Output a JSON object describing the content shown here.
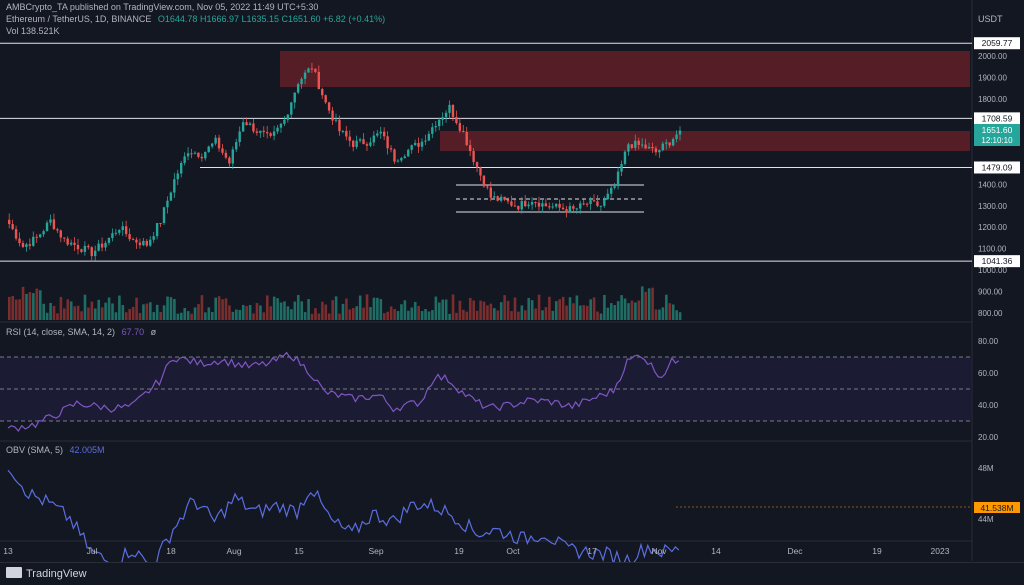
{
  "header": {
    "published": "AMBCrypto_TA published on TradingView.com, Nov 05, 2022 11:49 UTC+5:30",
    "symbol": "Ethereum / TetherUS, 1D, BINANCE",
    "ohlc": "O1644.78 H1666.97 L1635.15 C1651.60 +6.82 (+0.41%)",
    "vol": "Vol  138.521K",
    "currency": "USDT"
  },
  "indicators": {
    "rsi_label": "RSI (14, close, SMA, 14, 2)",
    "rsi_value": "67.70",
    "rsi_extra": "ø",
    "obv_label": "OBV (SMA, 5)",
    "obv_value": "42.005M"
  },
  "price_axis": {
    "ticks": [
      "2000.00",
      "1900.00",
      "1800.00",
      "1600.00",
      "1400.00",
      "1300.00",
      "1200.00",
      "1100.00",
      "1000.00",
      "900.00",
      "800.00"
    ],
    "levels": [
      "2059.77",
      "1708.59",
      "1479.09",
      "1041.36"
    ],
    "last_price": "1651.60",
    "countdown": "12:10:10"
  },
  "rsi_axis": {
    "ticks": [
      "80.00",
      "60.00",
      "40.00",
      "20.00"
    ]
  },
  "obv_axis": {
    "ticks": [
      "48M",
      "44M",
      "40M"
    ],
    "last": "41.538M"
  },
  "time_axis": [
    "13",
    "Jul",
    "18",
    "Aug",
    "15",
    "Sep",
    "19",
    "Oct",
    "17",
    "Nov",
    "14",
    "Dec",
    "19",
    "2023"
  ],
  "branding": {
    "logo": "TradingView"
  },
  "colors": {
    "up": "#26a69a",
    "down": "#ef5350",
    "zone": "#5d1e26",
    "line": "#7e57c2",
    "bg": "#131722"
  },
  "chart_data": [
    {
      "type": "candlestick",
      "title": "Ethereum / TetherUS, 1D, BINANCE",
      "x": [
        "2022-06-13",
        "2022-07-01",
        "2022-07-18",
        "2022-08-01",
        "2022-08-15",
        "2022-09-01",
        "2022-09-19",
        "2022-10-01",
        "2022-10-17",
        "2022-11-01"
      ],
      "close": [
        1210,
        1060,
        1560,
        1640,
        1900,
        1560,
        1340,
        1320,
        1330,
        1580
      ],
      "last": {
        "open": 1644.78,
        "high": 1666.97,
        "low": 1635.15,
        "close": 1651.6
      },
      "horizontal_levels": [
        2059.77,
        1708.59,
        1479.09,
        1041.36
      ],
      "resistance_zones": [
        [
          1860,
          2040
        ],
        [
          1560,
          1660
        ]
      ],
      "range_box": [
        1275,
        1400
      ],
      "ylim": [
        800,
        2100
      ]
    },
    {
      "type": "line",
      "title": "RSI (14, close, SMA, 14, 2)",
      "x": [
        "2022-06-13",
        "2022-07-01",
        "2022-07-18",
        "2022-08-01",
        "2022-08-15",
        "2022-09-01",
        "2022-09-19",
        "2022-10-01",
        "2022-10-17",
        "2022-11-01",
        "2022-11-05"
      ],
      "values": [
        25,
        36,
        63,
        59,
        56,
        42,
        37,
        41,
        47,
        66,
        67.7
      ],
      "bands": [
        70,
        50,
        30
      ],
      "ylim": [
        20,
        80
      ]
    },
    {
      "type": "line",
      "title": "OBV (SMA, 5)",
      "x": [
        "2022-06-13",
        "2022-07-01",
        "2022-07-18",
        "2022-08-01",
        "2022-08-15",
        "2022-09-01",
        "2022-09-19",
        "2022-10-01",
        "2022-10-17",
        "2022-11-01",
        "2022-11-05"
      ],
      "values": [
        48.3,
        40.5,
        43.7,
        45.0,
        45.3,
        44.4,
        43.2,
        41.4,
        40.4,
        41.4,
        41.538
      ],
      "unit": "M",
      "ylim": [
        39,
        49.5
      ]
    }
  ]
}
